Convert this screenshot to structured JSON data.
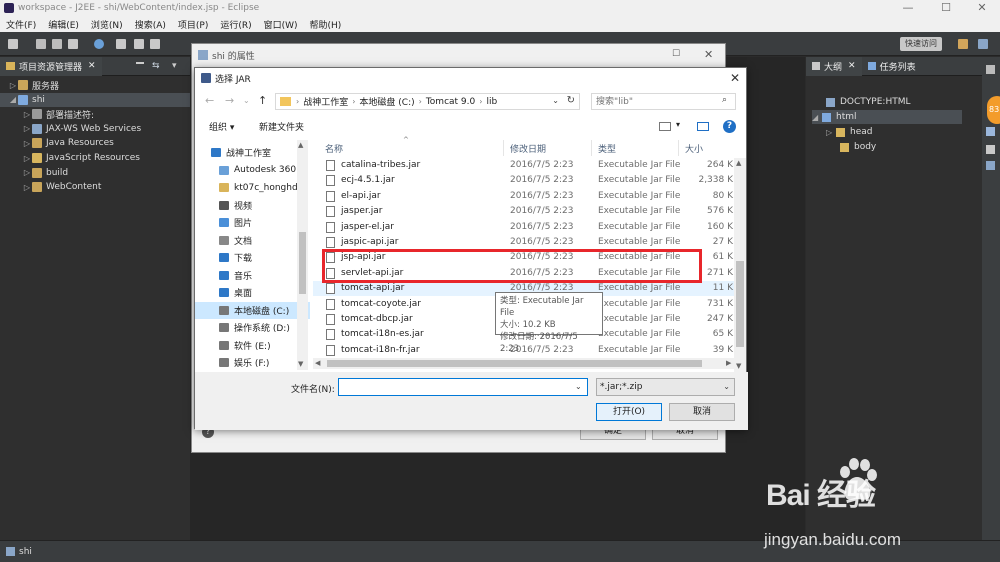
{
  "window": {
    "title": "workspace - J2EE - shi/WebContent/index.jsp - Eclipse"
  },
  "menu": [
    "文件(F)",
    "编辑(E)",
    "浏览(N)",
    "搜索(A)",
    "项目(P)",
    "运行(R)",
    "窗口(W)",
    "帮助(H)"
  ],
  "quick_access": "快速访问",
  "left_panel": {
    "tab": "项目资源管理器",
    "tree": [
      {
        "label": "服务器",
        "toggle": "▷"
      },
      {
        "label": "shi",
        "toggle": "◢"
      },
      {
        "label": "部署描述符:",
        "toggle": "▷"
      },
      {
        "label": "JAX-WS Web Services",
        "toggle": "▷"
      },
      {
        "label": "Java Resources",
        "toggle": "▷"
      },
      {
        "label": "JavaScript Resources",
        "toggle": "▷"
      },
      {
        "label": "build",
        "toggle": "▷"
      },
      {
        "label": "WebContent",
        "toggle": "▷"
      }
    ]
  },
  "right_panel": {
    "tab_outline": "大纲",
    "tab_tasks": "任务列表",
    "tree": [
      "DOCTYPE:HTML",
      "html",
      "head",
      "body"
    ]
  },
  "status": "shi",
  "badge": "83",
  "properties_dialog": {
    "title": "shi 的属性",
    "ok": "确定",
    "cancel": "取消"
  },
  "file_dialog": {
    "title": "选择 JAR",
    "breadcrumb": [
      "战神工作室",
      "本地磁盘 (C:)",
      "Tomcat 9.0",
      "lib"
    ],
    "search_placeholder": "搜索\"lib\"",
    "organize": "组织 ▾",
    "new_folder": "新建文件夹",
    "nav": [
      "战神工作室",
      "Autodesk 360",
      "kt07c_honghd",
      "视频",
      "图片",
      "文档",
      "下载",
      "音乐",
      "桌面",
      "本地磁盘 (C:)",
      "操作系统 (D:)",
      "软件 (E:)",
      "娱乐 (F:)"
    ],
    "columns": {
      "name": "名称",
      "date": "修改日期",
      "type": "类型",
      "size": "大小"
    },
    "files": [
      {
        "name": "catalina-tribes.jar",
        "date": "2016/7/5 2:23",
        "type": "Executable Jar File",
        "size": "264 K"
      },
      {
        "name": "ecj-4.5.1.jar",
        "date": "2016/7/5 2:23",
        "type": "Executable Jar File",
        "size": "2,338 K"
      },
      {
        "name": "el-api.jar",
        "date": "2016/7/5 2:23",
        "type": "Executable Jar File",
        "size": "80 K"
      },
      {
        "name": "jasper.jar",
        "date": "2016/7/5 2:23",
        "type": "Executable Jar File",
        "size": "576 K"
      },
      {
        "name": "jasper-el.jar",
        "date": "2016/7/5 2:23",
        "type": "Executable Jar File",
        "size": "160 K"
      },
      {
        "name": "jaspic-api.jar",
        "date": "2016/7/5 2:23",
        "type": "Executable Jar File",
        "size": "27 K"
      },
      {
        "name": "jsp-api.jar",
        "date": "2016/7/5 2:23",
        "type": "Executable Jar File",
        "size": "61 K"
      },
      {
        "name": "servlet-api.jar",
        "date": "2016/7/5 2:23",
        "type": "Executable Jar File",
        "size": "271 K"
      },
      {
        "name": "tomcat-api.jar",
        "date": "2016/7/5 2:23",
        "type": "Executable Jar File",
        "size": "11 K"
      },
      {
        "name": "tomcat-coyote.jar",
        "date": "2016/7/5 2:23",
        "type": "Executable Jar File",
        "size": "731 K"
      },
      {
        "name": "tomcat-dbcp.jar",
        "date": "2016/7/5 2:23",
        "type": "Executable Jar File",
        "size": "247 K"
      },
      {
        "name": "tomcat-i18n-es.jar",
        "date": "2016/7/5 2:23",
        "type": "Executable Jar File",
        "size": "65 K"
      },
      {
        "name": "tomcat-i18n-fr.jar",
        "date": "2016/7/5 2:23",
        "type": "Executable Jar File",
        "size": "39 K"
      }
    ],
    "tooltip": {
      "type": "类型: Executable Jar File",
      "size": "大小: 10.2 KB",
      "date": "修改日期: 2016/7/5 2:23"
    },
    "filename_label": "文件名(N):",
    "filename_value": "",
    "filter": "*.jar;*.zip",
    "open": "打开(O)",
    "cancel": "取消"
  },
  "watermark": {
    "brand": "Bai  经验",
    "url": "jingyan.baidu.com"
  },
  "colors": {
    "highlight_box": "#e8262b",
    "selection": "#cce8ff",
    "accent_blue": "#0078d7"
  }
}
